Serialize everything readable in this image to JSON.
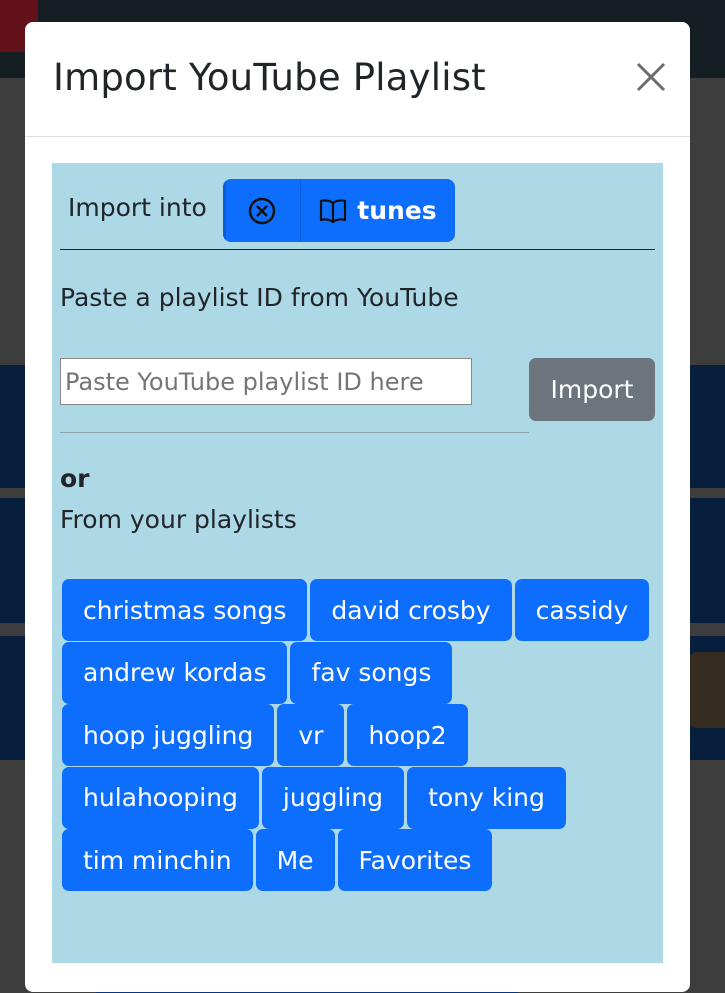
{
  "modal": {
    "title": "Import YouTube Playlist",
    "close_icon": "close-icon"
  },
  "import_into": {
    "label": "Import into",
    "clear_icon": "circle-x-icon",
    "book_icon": "book-icon",
    "target_label": "tunes"
  },
  "paste": {
    "label": "Paste a playlist ID from YouTube",
    "placeholder": "Paste YouTube playlist ID here",
    "value": "",
    "import_button": "Import"
  },
  "or_label": "or",
  "from_playlists_label": "From your playlists",
  "playlists": [
    "christmas songs",
    "david crosby",
    "cassidy",
    "andrew kordas",
    "fav songs",
    "hoop juggling",
    "vr",
    "hoop2",
    "hulahooping",
    "juggling",
    "tony king",
    "tim minchin",
    "Me",
    "Favorites"
  ],
  "colors": {
    "primary": "#0d6efd",
    "secondary": "#6c757d",
    "body_panel": "#add8e6",
    "backdrop": "rgba(0,0,0,0.5)"
  }
}
